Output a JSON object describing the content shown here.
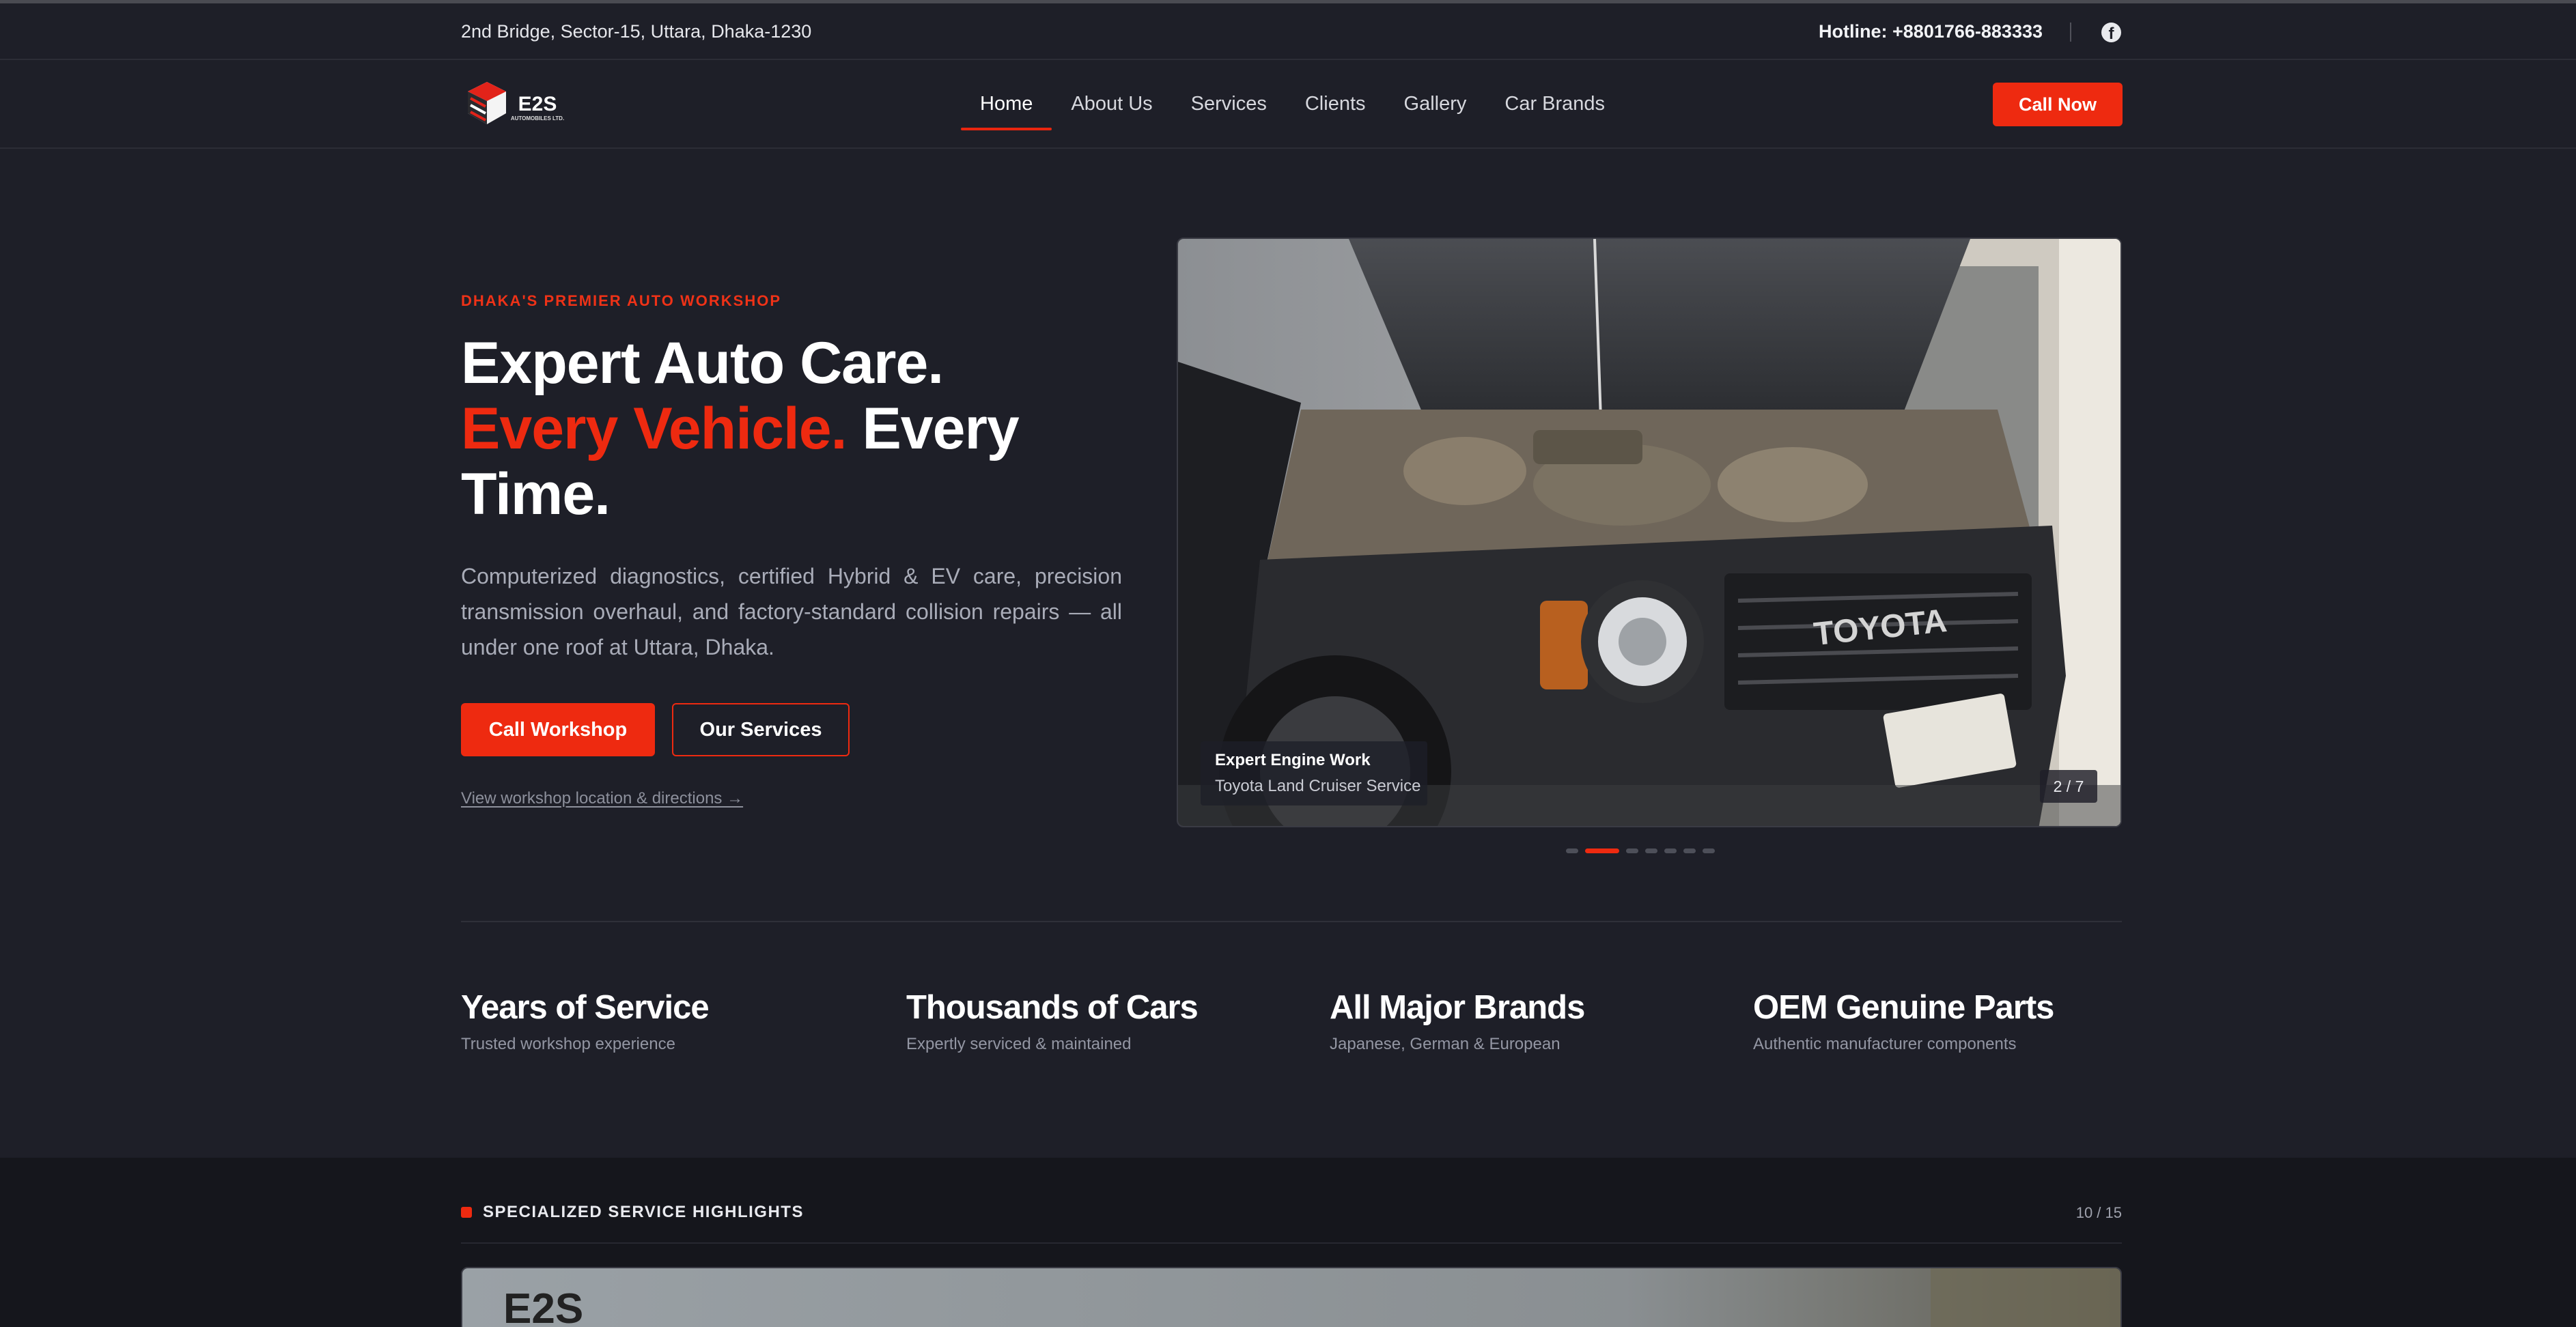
{
  "topbar": {
    "address": "2nd Bridge, Sector-15, Uttara, Dhaka-1230",
    "hotline": "Hotline: +8801766-883333",
    "social_icon": "facebook-icon"
  },
  "nav": {
    "logo_text": "E2S",
    "logo_sub": "AUTOMOBILES LTD.",
    "items": [
      {
        "label": "Home",
        "active": true
      },
      {
        "label": "About Us",
        "active": false
      },
      {
        "label": "Services",
        "active": false
      },
      {
        "label": "Clients",
        "active": false
      },
      {
        "label": "Gallery",
        "active": false
      },
      {
        "label": "Car Brands",
        "active": false
      }
    ],
    "cta": "Call Now"
  },
  "hero": {
    "eyebrow": "DHAKA'S PREMIER AUTO WORKSHOP",
    "headline_1": "Expert Auto Care.",
    "headline_red": "Every Vehicle.",
    "headline_2": "Every Time.",
    "description": "Computerized diagnostics, certified Hybrid & EV care, precision transmission overhaul, and factory-standard collision repairs — all under one roof at Uttara, Dhaka.",
    "btn_primary": "Call Workshop",
    "btn_secondary": "Our Services",
    "directions_link": "View workshop location & directions →"
  },
  "slider": {
    "caption_title": "Expert Engine Work",
    "caption_sub": "Toyota Land Cruiser Service",
    "counter": "2 / 7",
    "total_dots": 7,
    "active_dot": 2,
    "badge_text": "TOYOTA"
  },
  "stats": [
    {
      "value": "Years of Service",
      "label": "Trusted workshop experience"
    },
    {
      "value": "Thousands of Cars",
      "label": "Expertly serviced & maintained"
    },
    {
      "value": "All Major Brands",
      "label": "Japanese, German & European"
    },
    {
      "value": "OEM Genuine Parts",
      "label": "Authentic manufacturer components"
    }
  ],
  "highlights": {
    "title": "SPECIALIZED SERVICE HIGHLIGHTS",
    "count": "10 / 15"
  },
  "colors": {
    "accent": "#ee2a10",
    "background": "#1e1f28",
    "section_dark": "#15161c"
  }
}
